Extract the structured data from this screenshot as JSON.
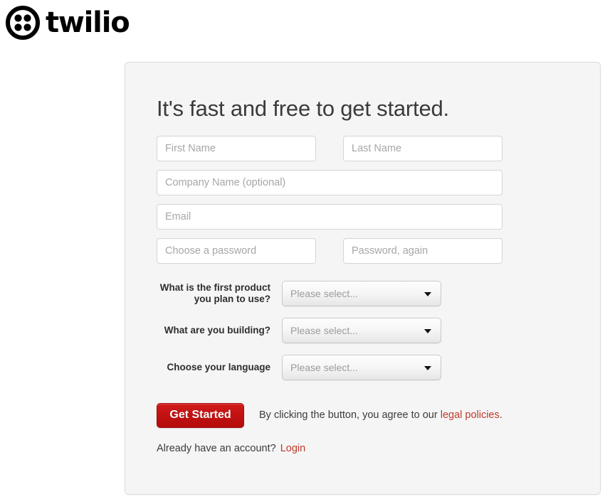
{
  "brand": {
    "logo_icon": "twilio-logo-icon",
    "wordmark": "twilio"
  },
  "signup": {
    "headline": "It's fast and free to get started.",
    "fields": {
      "first_name": {
        "placeholder": "First Name",
        "value": ""
      },
      "last_name": {
        "placeholder": "Last Name",
        "value": ""
      },
      "company_name": {
        "placeholder": "Company Name (optional)",
        "value": ""
      },
      "email": {
        "placeholder": "Email",
        "value": ""
      },
      "password": {
        "placeholder": "Choose a password",
        "value": ""
      },
      "password_confirm": {
        "placeholder": "Password, again",
        "value": ""
      }
    },
    "selects": [
      {
        "label_line1": "What is the first product",
        "label_line2": "you plan to use?",
        "selected": "Please select...",
        "arrow_icon": "chevron-down-icon"
      },
      {
        "label_line1": "What are you building?",
        "label_line2": "",
        "selected": "Please select...",
        "arrow_icon": "chevron-down-icon"
      },
      {
        "label_line1": "Choose your language",
        "label_line2": "",
        "selected": "Please select...",
        "arrow_icon": "chevron-down-icon"
      }
    ],
    "submit_label": "Get Started",
    "legal_prefix": "By clicking the button, you agree to our ",
    "legal_link": "legal policies",
    "legal_suffix": ".",
    "already_prefix": "Already have an account?",
    "login_link": "Login"
  },
  "colors": {
    "brand_red": "#c11111",
    "link_red": "#c0392b",
    "panel_bg": "#f5f5f5",
    "panel_border": "#dcdcdc",
    "page_bg": "#ffffff",
    "text": "#3c3c3c",
    "placeholder": "#a6a6a6"
  }
}
